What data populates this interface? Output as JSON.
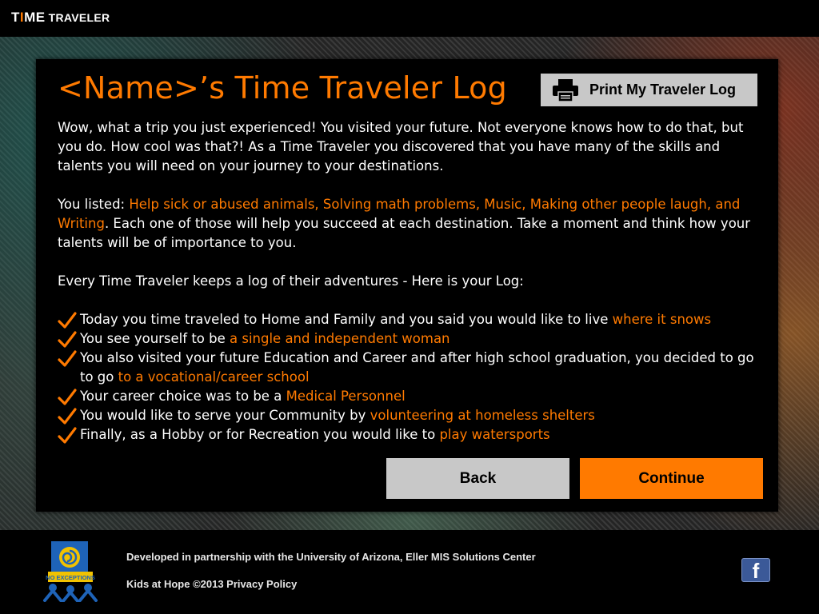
{
  "header": {
    "logo_prefix": "T",
    "logo_accent": "I",
    "logo_suffix": "ME",
    "logo_small": "TRAVELER"
  },
  "panel": {
    "title": "<Name>’s Time Traveler Log",
    "print_button": "Print My Traveler Log",
    "intro": "Wow, what a trip you just experienced! You visited your future. Not everyone knows how to do that, but you do. How cool was that?!  As a Time Traveler you discovered that you have many of the skills and talents you will need on your journey to your destinations.",
    "listed_prefix": "You listed: ",
    "listed_items": "Help sick or abused animals, Solving math problems, Music, Making other people laugh, and Writing",
    "listed_suffix": ".  Each one of those will help you succeed at each destination. Take a moment and think how your talents will be of importance to you.",
    "log_intro": "Every Time Traveler keeps a log of their adventures - Here is your Log:",
    "log_items": [
      {
        "text": "Today you time traveled to Home and Family and you said you would like to live ",
        "highlight": "where it snows"
      },
      {
        "text": "You see yourself to be ",
        "highlight": "a single and independent woman"
      },
      {
        "text": "You also visited your future Education and Career and after high school graduation, you decided to go to go ",
        "highlight": "to a vocational/career school"
      },
      {
        "text": "Your career choice was to be a ",
        "highlight": "Medical Personnel"
      },
      {
        "text": "You would like to serve your Community by ",
        "highlight": "volunteering at homeless shelters"
      },
      {
        "text": "Finally, as a Hobby or for Recreation you would like to ",
        "highlight": "play watersports"
      }
    ],
    "back_button": "Back",
    "continue_button": "Continue"
  },
  "footer": {
    "partnership": "Developed in partnership with the University of Arizona, Eller MIS Solutions Center",
    "copyright": "Kids at Hope ©2013 Privacy Policy",
    "facebook_letter": "f",
    "badge_text": "NO EXCEPTIONS"
  },
  "colors": {
    "accent": "#ff7a00",
    "button_gray": "#c8c8c8",
    "facebook_blue": "#3b5998"
  }
}
